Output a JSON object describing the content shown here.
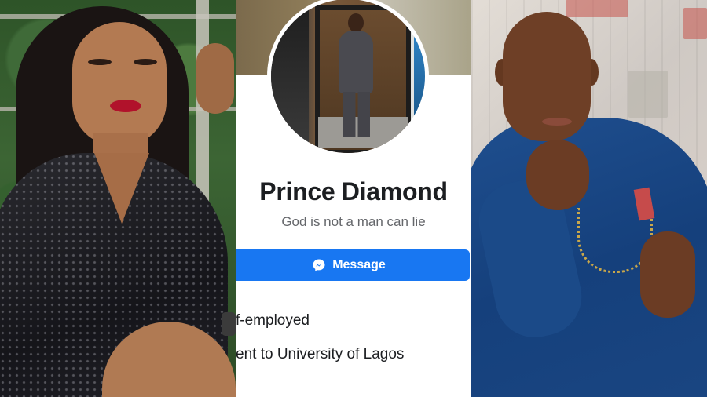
{
  "profile": {
    "name": "Prince Diamond",
    "bio": "God is not a man can lie",
    "message_label": "Message",
    "work_text": "f-employed",
    "education_text": "ent to University of Lagos"
  },
  "icons": {
    "messenger": "messenger-icon"
  },
  "colors": {
    "messenger_blue": "#1877f2",
    "name_text": "#1c1e21",
    "bio_text": "#65676b",
    "divider": "#dadde1"
  }
}
